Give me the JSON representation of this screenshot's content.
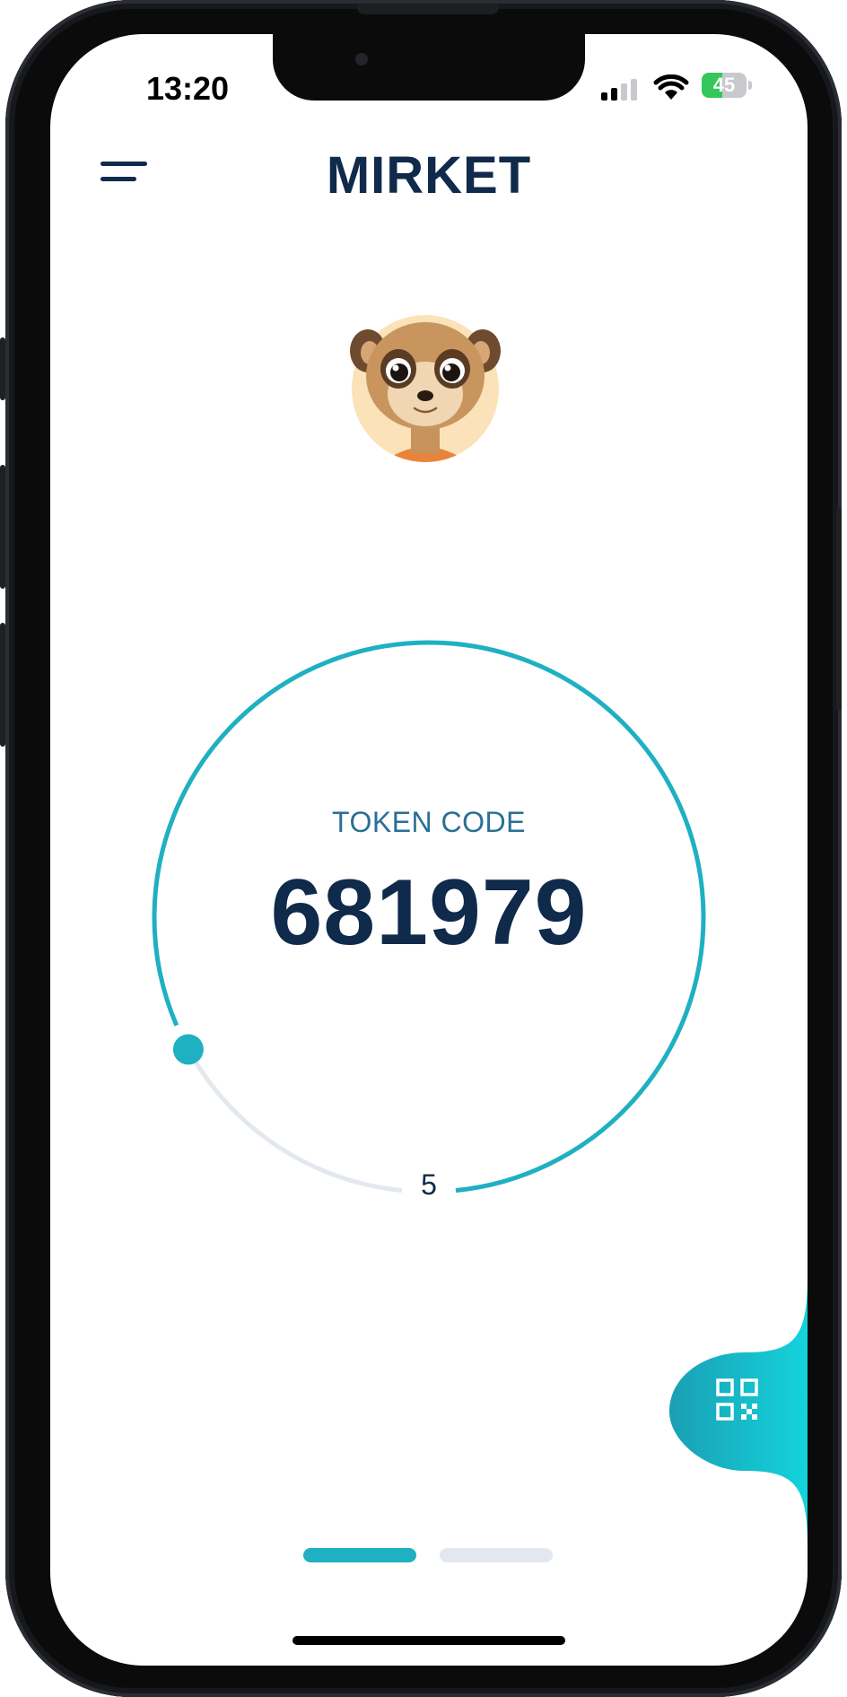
{
  "status_bar": {
    "time": "13:20",
    "battery_level": "45",
    "battery_charging": true
  },
  "header": {
    "menu_icon": "menu-icon",
    "logo_text": "MIRKET"
  },
  "avatar": {
    "icon": "meerkat-avatar"
  },
  "token": {
    "label": "TOKEN CODE",
    "code": "681979",
    "seconds_remaining": "5",
    "progress_fraction": 0.83
  },
  "qr_button": {
    "icon": "qr-code-icon"
  },
  "page_indicator": {
    "pages": 2,
    "active": 0
  },
  "colors": {
    "accent": "#1fb0c2",
    "brand_navy": "#0f2a4a",
    "track": "#e3e8ef",
    "label_blue": "#2a6f96"
  }
}
